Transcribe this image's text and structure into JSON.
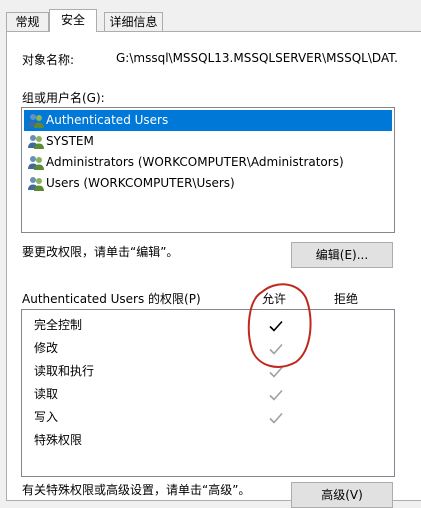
{
  "tabs": [
    {
      "label": "常规"
    },
    {
      "label": "安全"
    },
    {
      "label": "详细信息"
    }
  ],
  "object_name": {
    "label": "对象名称:",
    "value": "G:\\mssql\\MSSQL13.MSSQLSERVER\\MSSQL\\DAT."
  },
  "groups": {
    "label": "组或用户名(G):",
    "items": [
      {
        "name": "Authenticated Users",
        "selected": true,
        "icon": "users-group-icon"
      },
      {
        "name": "SYSTEM",
        "selected": false,
        "icon": "users-group-icon"
      },
      {
        "name": "Administrators (WORKCOMPUTER\\Administrators)",
        "selected": false,
        "icon": "users-group-icon"
      },
      {
        "name": "Users (WORKCOMPUTER\\Users)",
        "selected": false,
        "icon": "users-group-icon"
      }
    ]
  },
  "edit": {
    "hint": "要更改权限，请单击“编辑”。",
    "button_label": "编辑(E)..."
  },
  "permissions": {
    "title": "Authenticated Users 的权限(P)",
    "allow_header": "允许",
    "deny_header": "拒绝",
    "rows": [
      {
        "name": "完全控制",
        "allow": "check-enabled",
        "deny": "none"
      },
      {
        "name": "修改",
        "allow": "check-greyed",
        "deny": "none"
      },
      {
        "name": "读取和执行",
        "allow": "check-greyed",
        "deny": "none"
      },
      {
        "name": "读取",
        "allow": "check-greyed",
        "deny": "none"
      },
      {
        "name": "写入",
        "allow": "check-greyed",
        "deny": "none"
      },
      {
        "name": "特殊权限",
        "allow": "none",
        "deny": "none"
      }
    ]
  },
  "advanced": {
    "hint": "有关特殊权限或高级设置，请单击“高级”。",
    "button_label": "高级(V)"
  },
  "colors": {
    "selection": "#0078d7",
    "check_enabled": "#000000",
    "check_greyed": "#a0a0a0",
    "annotation_circle": "#c0281e"
  }
}
